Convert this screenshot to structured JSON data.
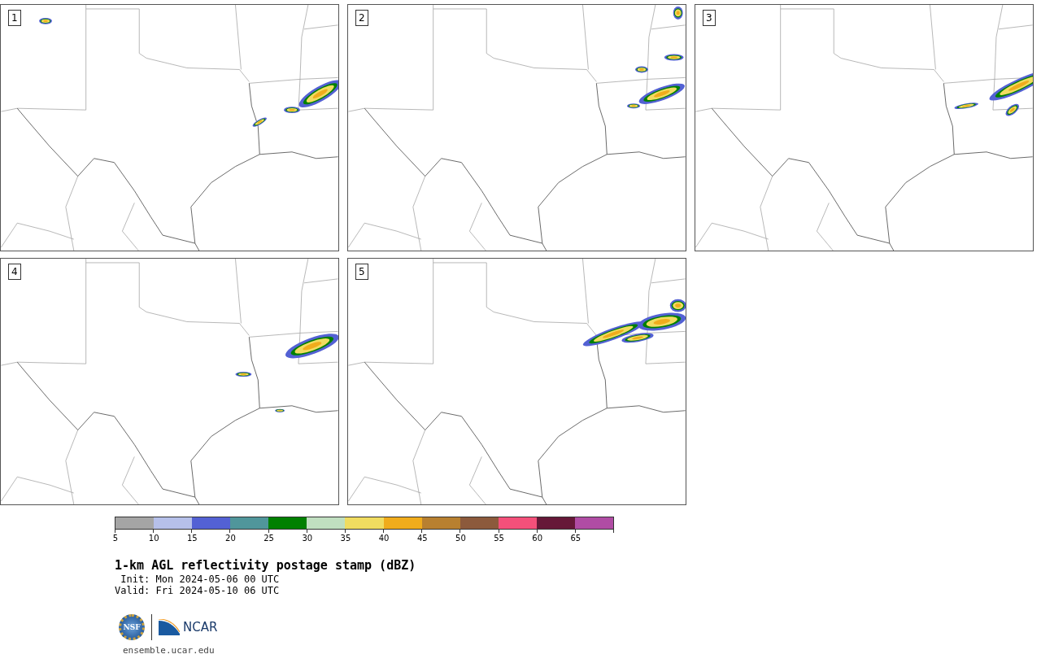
{
  "panels": [
    {
      "number": "1"
    },
    {
      "number": "2"
    },
    {
      "number": "3"
    },
    {
      "number": "4"
    },
    {
      "number": "5"
    }
  ],
  "colorbar": {
    "segments": [
      {
        "color": "#a5a5a5"
      },
      {
        "color": "#b6c0ea"
      },
      {
        "color": "#5361d4"
      },
      {
        "color": "#50969b"
      },
      {
        "color": "#008000"
      },
      {
        "color": "#c0dfc0"
      },
      {
        "color": "#f0dc60"
      },
      {
        "color": "#f0ac1c"
      },
      {
        "color": "#b88030"
      },
      {
        "color": "#8c5a3c"
      },
      {
        "color": "#f4507a"
      },
      {
        "color": "#661838"
      },
      {
        "color": "#b04ca4"
      }
    ],
    "ticks": [
      "5",
      "10",
      "15",
      "20",
      "25",
      "30",
      "35",
      "40",
      "45",
      "50",
      "55",
      "60",
      "65"
    ]
  },
  "title": "1-km AGL reflectivity postage stamp (dBZ)",
  "init": " Init: Mon 2024-05-06 00 UTC",
  "valid": "Valid: Fri 2024-05-10 06 UTC",
  "logos": {
    "nsf": "NSF",
    "ncar": "NCAR"
  },
  "site": "ensemble.ucar.edu"
}
